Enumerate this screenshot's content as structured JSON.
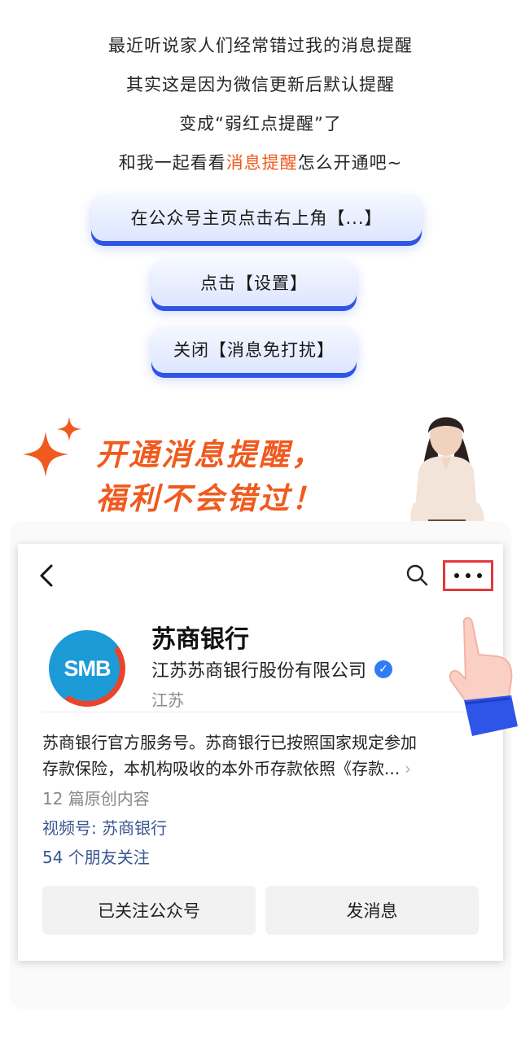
{
  "intro": {
    "line1": "最近听说家人们经常错过我的消息提醒",
    "line2": "其实这是因为微信更新后默认提醒",
    "line3": "变成“弱红点提醒”了",
    "line4_pre": "和我一起看看",
    "line4_highlight": "消息提醒",
    "line4_post": "怎么开通吧~"
  },
  "steps": [
    {
      "label": "在公众号主页点击右上角【...】"
    },
    {
      "label": "点击【设置】"
    },
    {
      "label": "关闭【消息免打扰】"
    }
  ],
  "slogan": {
    "line1": "开通消息提醒，",
    "line2": "福利不会错过！"
  },
  "profile": {
    "logo_text": "SMB",
    "name": "苏商银行",
    "company": "江苏苏商银行股份有限公司",
    "region": "江苏",
    "description_line1": "苏商银行官方服务号。苏商银行已按照国家规定参加",
    "description_line2": "存款保险，本机构吸收的本外币存款依照《存款...",
    "original_count": "12 篇原创内容",
    "video_channel": "视频号: 苏商银行",
    "friends_following": "54 个朋友关注",
    "followed_button": "已关注公众号",
    "message_button": "发消息"
  },
  "colors": {
    "accent_orange": "#f05a1e",
    "pill_shadow_blue": "#2f55e8",
    "highlight_red": "#e5383b",
    "link_blue": "#3a5591",
    "verified_blue": "#2f7df6"
  },
  "icons": [
    "back-arrow-icon",
    "search-icon",
    "more-dots-icon",
    "verified-icon",
    "sparkle-icon",
    "pointing-hand-icon",
    "chevron-right-icon"
  ]
}
